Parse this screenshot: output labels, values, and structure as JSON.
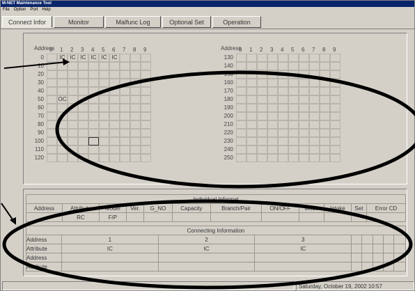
{
  "window": {
    "title": "M-NET Maintenance Tool"
  },
  "menu": [
    "File",
    "Option",
    "Port",
    "Help"
  ],
  "tabs": [
    "Connect  Infor",
    "Monitor",
    "Malfunc Log",
    "Optional Set",
    "Operation"
  ],
  "grid_left": {
    "header": "Address",
    "cols": [
      "0",
      "1",
      "2",
      "3",
      "4",
      "5",
      "6",
      "7",
      "8",
      "9"
    ],
    "rows": [
      "0",
      "10",
      "20",
      "30",
      "40",
      "50",
      "60",
      "70",
      "80",
      "90",
      "100",
      "110",
      "120"
    ],
    "cells": [
      {
        "row": 0,
        "col": 1,
        "text": "IC"
      },
      {
        "row": 0,
        "col": 2,
        "text": "IC"
      },
      {
        "row": 0,
        "col": 3,
        "text": "IC"
      },
      {
        "row": 0,
        "col": 4,
        "text": "IC"
      },
      {
        "row": 0,
        "col": 5,
        "text": "IC"
      },
      {
        "row": 0,
        "col": 6,
        "text": "IC"
      },
      {
        "row": 5,
        "col": 1,
        "text": "OC"
      }
    ]
  },
  "grid_right": {
    "header": "Address",
    "cols": [
      "0",
      "1",
      "2",
      "3",
      "4",
      "5",
      "6",
      "7",
      "8",
      "9"
    ],
    "rows": [
      "130",
      "140",
      "150",
      "160",
      "170",
      "180",
      "190",
      "200",
      "210",
      "220",
      "230",
      "240",
      "250"
    ]
  },
  "individual": {
    "title": "Individual Informat",
    "headers": [
      "Address",
      "Attribute",
      "Model",
      "Ver.",
      "G_NO",
      "Capacity",
      "Branch/Pair",
      "ON/OFF",
      "Mode",
      "Intake",
      "Set",
      "Error CD"
    ],
    "values": [
      "",
      "RC",
      "F/P",
      "",
      "",
      "",
      "",
      "",
      "",
      "",
      "",
      ""
    ]
  },
  "connecting": {
    "title": "Connecting Information",
    "rows": [
      {
        "label": "Address",
        "cells": [
          "1",
          "2",
          "3",
          "",
          "",
          "",
          "",
          ""
        ]
      },
      {
        "label": "Attribute",
        "cells": [
          "IC",
          "IC",
          "IC",
          "",
          "",
          "",
          "",
          ""
        ]
      },
      {
        "label": "Address",
        "cells": [
          "",
          "",
          "",
          "",
          "",
          "",
          "",
          ""
        ]
      },
      {
        "label": "Attribute",
        "cells": [
          "",
          "",
          "",
          "",
          "",
          "",
          "",
          ""
        ]
      }
    ]
  },
  "status": {
    "datetime": "Saturday, October 19, 2002  10:57"
  }
}
